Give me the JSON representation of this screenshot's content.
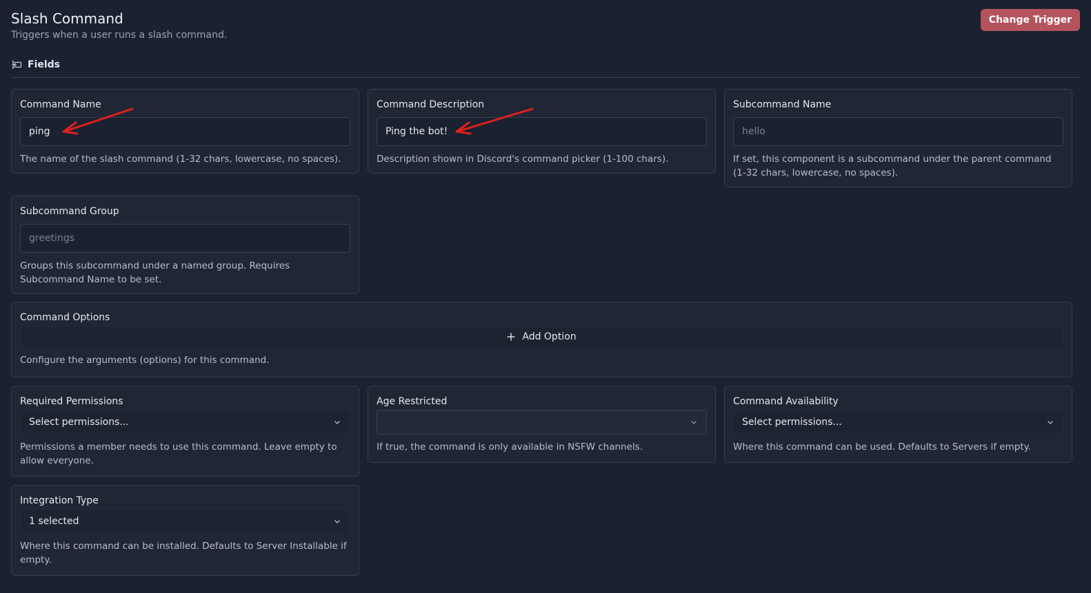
{
  "header": {
    "title": "Slash Command",
    "subtitle": "Triggers when a user runs a slash command.",
    "change_trigger_label": "Change Trigger"
  },
  "section": {
    "label": "Fields"
  },
  "fields": {
    "command_name": {
      "label": "Command Name",
      "value": "ping",
      "help": "The name of the slash command (1-32 chars, lowercase, no spaces)."
    },
    "command_description": {
      "label": "Command Description",
      "value": "Ping the bot!",
      "help": "Description shown in Discord's command picker (1-100 chars)."
    },
    "subcommand_name": {
      "label": "Subcommand Name",
      "placeholder": "hello",
      "help": "If set, this component is a subcommand under the parent command (1-32 chars, lowercase, no spaces)."
    },
    "subcommand_group": {
      "label": "Subcommand Group",
      "placeholder": "greetings",
      "help": "Groups this subcommand under a named group. Requires Subcommand Name to be set."
    },
    "command_options": {
      "label": "Command Options",
      "add_label": "Add Option",
      "help": "Configure the arguments (options) for this command."
    },
    "required_permissions": {
      "label": "Required Permissions",
      "selected": "Select permissions...",
      "help": "Permissions a member needs to use this command. Leave empty to allow everyone."
    },
    "age_restricted": {
      "label": "Age Restricted",
      "selected": "",
      "help": "If true, the command is only available in NSFW channels."
    },
    "command_availability": {
      "label": "Command Availability",
      "selected": "Select permissions...",
      "help": "Where this command can be used. Defaults to Servers if empty."
    },
    "integration_type": {
      "label": "Integration Type",
      "selected": "1 selected",
      "help": "Where this command can be installed. Defaults to Server Installable if empty."
    }
  },
  "colors": {
    "background": "#1a2130",
    "card": "#1f2634",
    "accent_button": "#b5535c",
    "annotation_arrow": "#e0201c"
  }
}
